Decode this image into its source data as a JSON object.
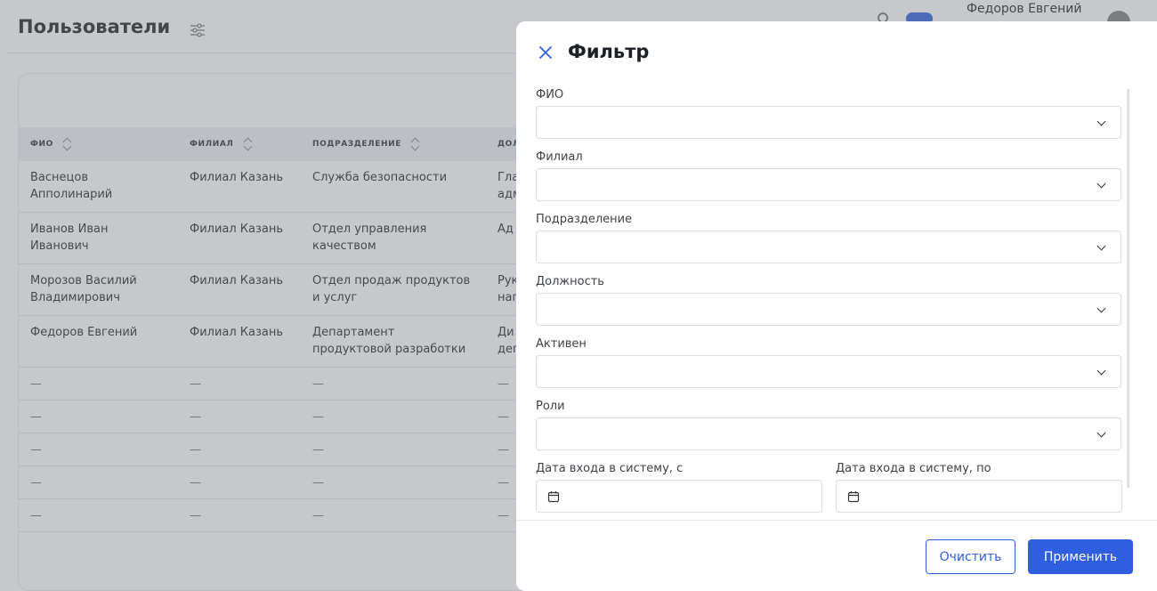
{
  "header": {
    "title": "Пользователи",
    "user_name": "Федоров Евгений"
  },
  "table": {
    "columns": [
      "ФИО",
      "ФИЛИАЛ",
      "ПОДРАЗДЕЛЕНИЕ",
      "ДОЛ"
    ],
    "rows": [
      {
        "fio": "Васнецов\nАпполинарий",
        "branch": "Филиал Казань",
        "division": "Служба безопасности",
        "position": "Гла\nадм"
      },
      {
        "fio": "Иванов Иван\nИванович",
        "branch": "Филиал Казань",
        "division": "Отдел управления\nкачеством",
        "position": "Ад"
      },
      {
        "fio": "Морозов Василий\nВладимирович",
        "branch": "Филиал Казань",
        "division": "Отдел продаж продуктов\nи услуг",
        "position": "Рук\nнап"
      },
      {
        "fio": "Федоров Евгений",
        "branch": "Филиал Казань",
        "division": "Департамент\nпродуктовой разработки",
        "position": "Ди\nдеп"
      }
    ],
    "empty_placeholder": "—",
    "empty_rows": 5
  },
  "filter": {
    "title": "Фильтр",
    "fields": {
      "fio": "ФИО",
      "branch": "Филиал",
      "division": "Подразделение",
      "position": "Должность",
      "active": "Активен",
      "roles": "Роли",
      "date_from": "Дата входа в систему, с",
      "date_to": "Дата входа в систему, по"
    },
    "clear_label": "Очистить",
    "apply_label": "Применить"
  },
  "colors": {
    "accent": "#2f5fe0",
    "overlay": "rgba(120,124,130,0.42)"
  }
}
